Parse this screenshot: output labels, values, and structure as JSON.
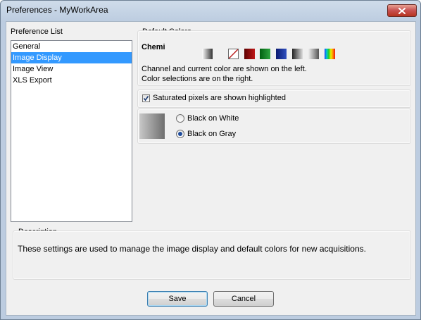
{
  "window": {
    "title": "Preferences - MyWorkArea"
  },
  "preference_list": {
    "label": "Preference List",
    "items": [
      {
        "label": "General",
        "selected": false
      },
      {
        "label": "Image Display",
        "selected": true
      },
      {
        "label": "Image View",
        "selected": false
      },
      {
        "label": "XLS Export",
        "selected": false
      }
    ]
  },
  "default_colors": {
    "label": "Default Colors",
    "channel": "Chemi",
    "swatch_names": [
      "current-gray-gradient",
      "none",
      "red",
      "green",
      "blue",
      "dark-gray-gradient",
      "light-gray-gradient",
      "rainbow"
    ],
    "note_line1": "Channel and current color are shown on the left.",
    "note_line2": "Color selections are on the right."
  },
  "saturated": {
    "label": "Saturated pixels are shown highlighted",
    "checked": true
  },
  "background": {
    "options": [
      {
        "label": "Black on White",
        "selected": false
      },
      {
        "label": "Black on Gray",
        "selected": true
      }
    ]
  },
  "description": {
    "label": "Description",
    "text": "These settings are used to manage the image display and default colors for new acquisitions."
  },
  "buttons": {
    "save": "Save",
    "cancel": "Cancel"
  },
  "colors": {
    "selection": "#3399ff",
    "close_button": "#c75050"
  }
}
